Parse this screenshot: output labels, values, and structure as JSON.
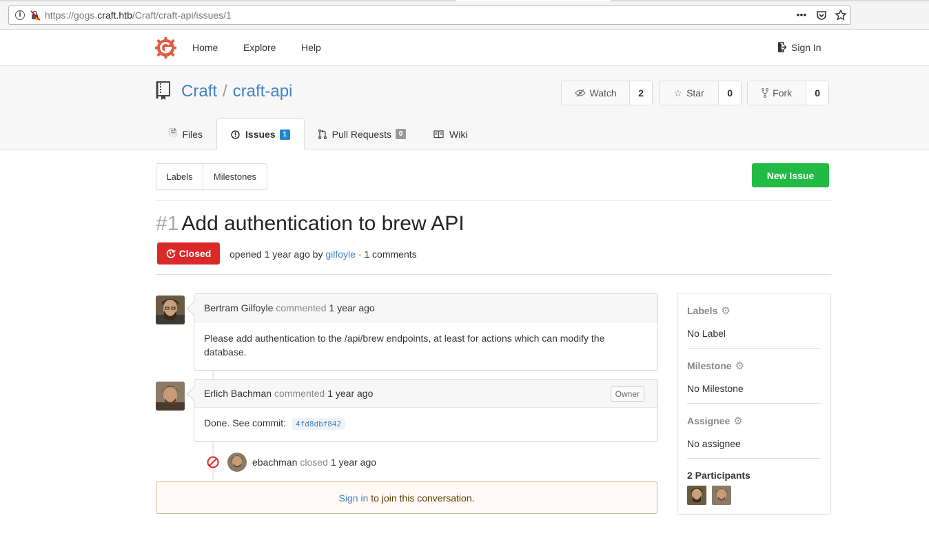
{
  "browser": {
    "url_prefix": "https://gogs.",
    "url_domain": "craft.htb",
    "url_path": "/Craft/craft-api/issues/1"
  },
  "header": {
    "nav": [
      "Home",
      "Explore",
      "Help"
    ],
    "sign_in": "Sign In"
  },
  "repo": {
    "owner": "Craft",
    "separator": "/",
    "name": "craft-api",
    "watch_label": "Watch",
    "watch_count": "2",
    "star_label": "Star",
    "star_count": "0",
    "fork_label": "Fork",
    "fork_count": "0",
    "tabs": [
      {
        "label": "Files"
      },
      {
        "label": "Issues",
        "badge": "1"
      },
      {
        "label": "Pull Requests",
        "badge": "0"
      },
      {
        "label": "Wiki"
      }
    ]
  },
  "toolbar": {
    "labels": "Labels",
    "milestones": "Milestones",
    "new_issue": "New Issue"
  },
  "issue": {
    "number": "#1",
    "title": "Add authentication to brew API",
    "status": "Closed",
    "opened": "opened 1 year ago by",
    "author": "gilfoyle",
    "comments_count": "· 1 comments"
  },
  "comments": [
    {
      "author": "Bertram Gilfoyle",
      "action": "commented",
      "time": "1 year ago",
      "body": "Please add authentication to the /api/brew endpoints, at least for actions which can modify the database."
    },
    {
      "author": "Erlich Bachman",
      "action": "commented",
      "time": "1 year ago",
      "tag": "Owner",
      "body": "Done. See commit:",
      "commit": "4fd8dbf842"
    }
  ],
  "event": {
    "user": "ebachman",
    "action": "closed",
    "time": "1 year ago"
  },
  "signin_prompt": {
    "link": "Sign in",
    "text": "to join this conversation."
  },
  "sidebar": {
    "labels_title": "Labels",
    "labels_value": "No Label",
    "milestone_title": "Milestone",
    "milestone_value": "No Milestone",
    "assignee_title": "Assignee",
    "assignee_value": "No assignee",
    "participants": "2 Participants"
  }
}
